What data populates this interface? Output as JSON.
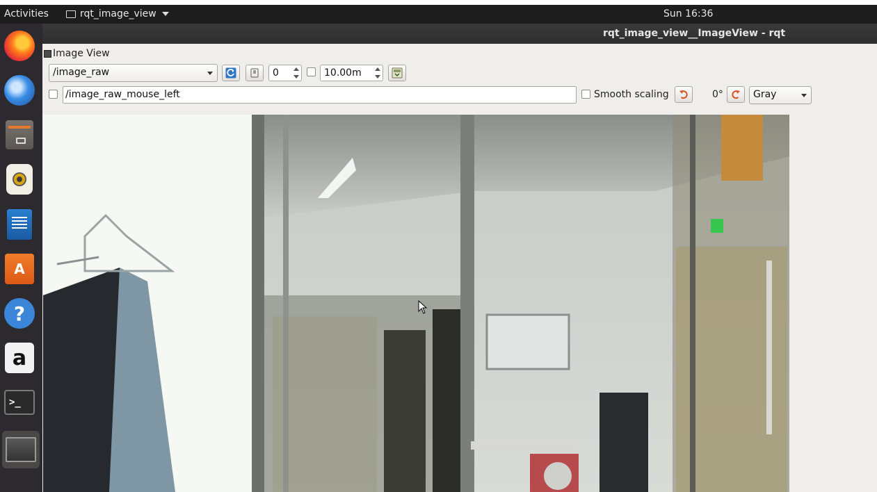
{
  "topbar": {
    "activities": "Activities",
    "app_name": "rqt_image_view",
    "clock": "Sun 16:36"
  },
  "window": {
    "title": "rqt_image_view__ImageView - rqt"
  },
  "dock": {
    "apps": [
      {
        "name": "Firefox",
        "icon": "firefox-icon"
      },
      {
        "name": "Thunderbird",
        "icon": "thunderbird-icon"
      },
      {
        "name": "Files",
        "icon": "files-icon"
      },
      {
        "name": "Rhythmbox",
        "icon": "rhythmbox-icon"
      },
      {
        "name": "LibreOffice Writer",
        "icon": "writer-icon"
      },
      {
        "name": "Ubuntu Software",
        "icon": "software-store-icon",
        "glyph": "A"
      },
      {
        "name": "Help",
        "icon": "help-icon",
        "glyph": "?"
      },
      {
        "name": "Amazon",
        "icon": "amazon-icon",
        "glyph": "a"
      },
      {
        "name": "Terminal",
        "icon": "terminal-icon",
        "glyph": ">_"
      },
      {
        "name": "rqt window",
        "icon": "window-icon"
      }
    ]
  },
  "plugin": {
    "dock_title": "Image View",
    "topic": "/image_raw",
    "spin_value": "0",
    "duration_value": "10.00m",
    "mouse_topic": "/image_raw_mouse_left",
    "smooth_scaling_label": "Smooth scaling",
    "rotation": "0°",
    "color_scheme": "Gray"
  }
}
